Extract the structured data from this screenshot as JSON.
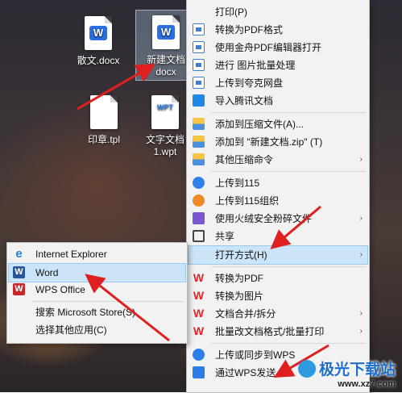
{
  "desktop": {
    "icons": [
      {
        "label": "散文.docx",
        "glyph": "W"
      },
      {
        "label": "新建文档",
        "label2": "docx",
        "glyph": "W"
      },
      {
        "label": "印章.tpl",
        "glyph": ""
      },
      {
        "label": "文字文档",
        "label2": "1.wpt",
        "glyph": "WPT"
      }
    ]
  },
  "main_menu": {
    "items": [
      {
        "label": "打印(P)"
      },
      {
        "label": "转换为PDF格式",
        "icon": "doc-icon"
      },
      {
        "label": "使用金舟PDF编辑器打开",
        "icon": "doc-icon"
      },
      {
        "label": "进行 图片批量处理",
        "icon": "doc-icon"
      },
      {
        "label": "上传到夸克网盘",
        "icon": "doc-icon"
      },
      {
        "label": "导入腾讯文档",
        "icon": "tencent-docs-icon"
      },
      {
        "label": "添加到压缩文件(A)...",
        "icon": "archive-icon"
      },
      {
        "label": "添加到 \"新建文档.zip\" (T)",
        "icon": "archive-icon"
      },
      {
        "label": "其他压缩命令",
        "icon": "archive-icon",
        "has_submenu": true
      },
      {
        "label": "上传到115",
        "icon": "cloud-upload-icon"
      },
      {
        "label": "上传到115组织",
        "icon": "cloud-org-icon"
      },
      {
        "label": "使用火绒安全粉碎文件",
        "icon": "shredder-icon",
        "has_submenu": true
      },
      {
        "label": "共享",
        "icon": "share-icon"
      },
      {
        "label": "打开方式(H)",
        "has_submenu": true,
        "highlighted": true
      },
      {
        "label": "转换为PDF",
        "icon": "wps-icon"
      },
      {
        "label": "转换为图片",
        "icon": "wps-icon"
      },
      {
        "label": "文档合并/拆分",
        "icon": "wps-icon",
        "has_submenu": true
      },
      {
        "label": "批量改文档格式/批量打印",
        "icon": "wps-icon",
        "has_submenu": true
      },
      {
        "label": "上传或同步到WPS",
        "icon": "cloud-sync-icon"
      },
      {
        "label": "通过WPS发送",
        "icon": "send-icon"
      }
    ],
    "arrow_glyph": "›"
  },
  "open_with_menu": {
    "items": [
      {
        "label": "Internet Explorer",
        "icon": "internet-explorer-icon",
        "glyph": "e"
      },
      {
        "label": "Word",
        "icon": "word-icon",
        "glyph": "W",
        "highlighted": true
      },
      {
        "label": "WPS Office",
        "icon": "wps-office-icon",
        "glyph": "W"
      },
      {
        "label": "搜索 Microsoft Store(S)",
        "icon": "store-icon"
      },
      {
        "label": "选择其他应用(C)"
      }
    ]
  },
  "watermark": {
    "text": "极光下载站",
    "url": "www.xz7.com"
  },
  "colors": {
    "menu_bg": "#f2f2f2",
    "highlight": "#cce4f7",
    "annotation_arrow": "#e02020"
  }
}
